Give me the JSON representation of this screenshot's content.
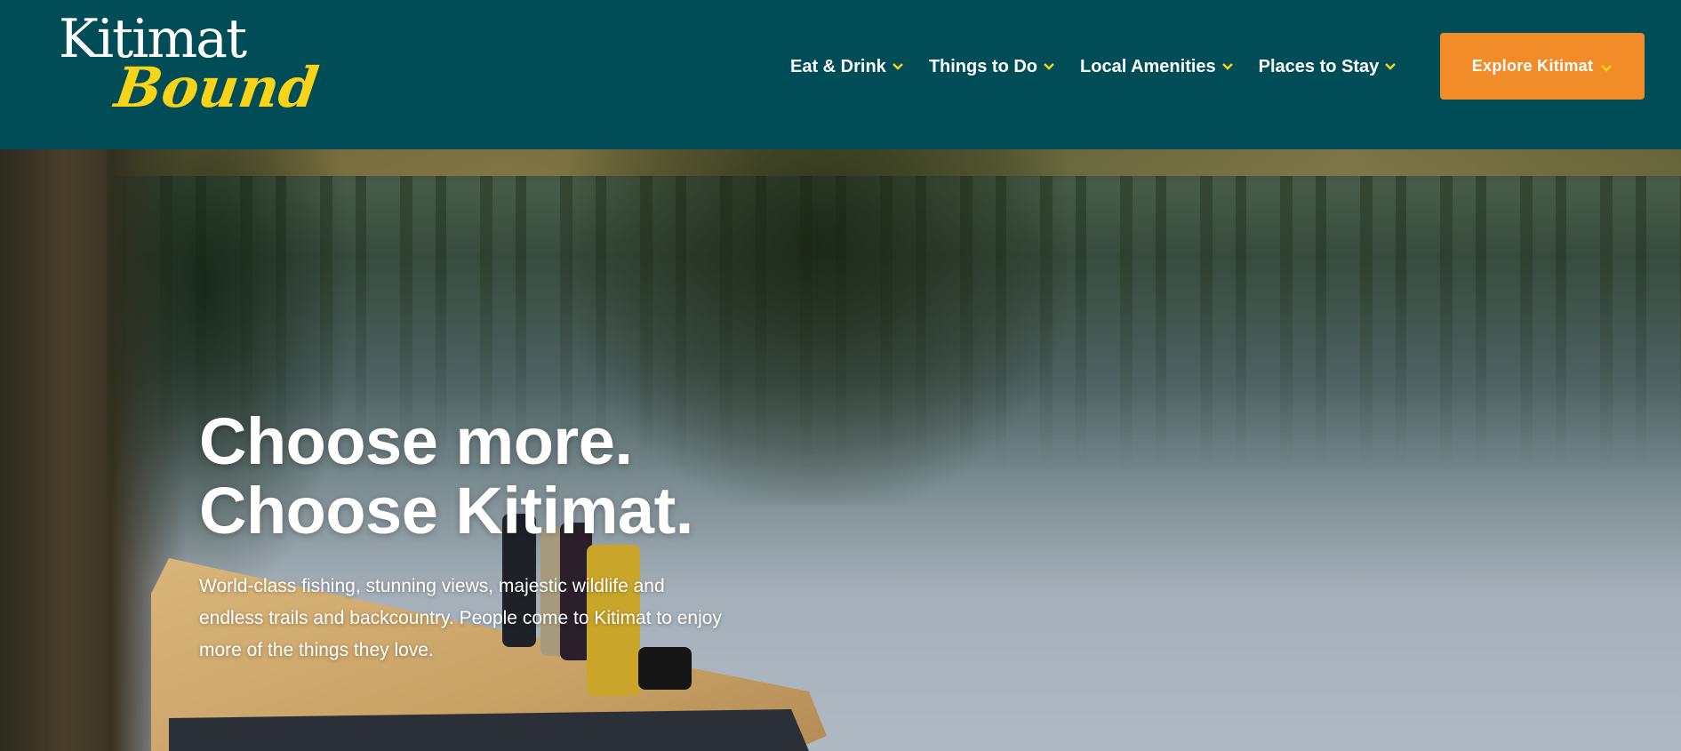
{
  "brand": {
    "logo_line1": "Kitimat",
    "logo_line2": "Bound"
  },
  "nav": {
    "items": [
      {
        "label": "Eat & Drink",
        "icon": "chevron-down-icon"
      },
      {
        "label": "Things to Do",
        "icon": "chevron-down-icon"
      },
      {
        "label": "Local Amenities",
        "icon": "chevron-down-icon"
      },
      {
        "label": "Places to Stay",
        "icon": "chevron-down-icon"
      }
    ],
    "cta_label": "Explore Kitimat"
  },
  "hero": {
    "title_line1": "Choose more.",
    "title_line2": "Choose Kitimat.",
    "subtitle": "World-class fishing, stunning views, majestic wildlife and endless trails and backcountry. People come to Kitimat to enjoy more of the things they love."
  },
  "colors": {
    "header_bg": "#004d57",
    "accent_yellow": "#f7d417",
    "cta_orange": "#f28c28",
    "text_white": "#ffffff"
  }
}
